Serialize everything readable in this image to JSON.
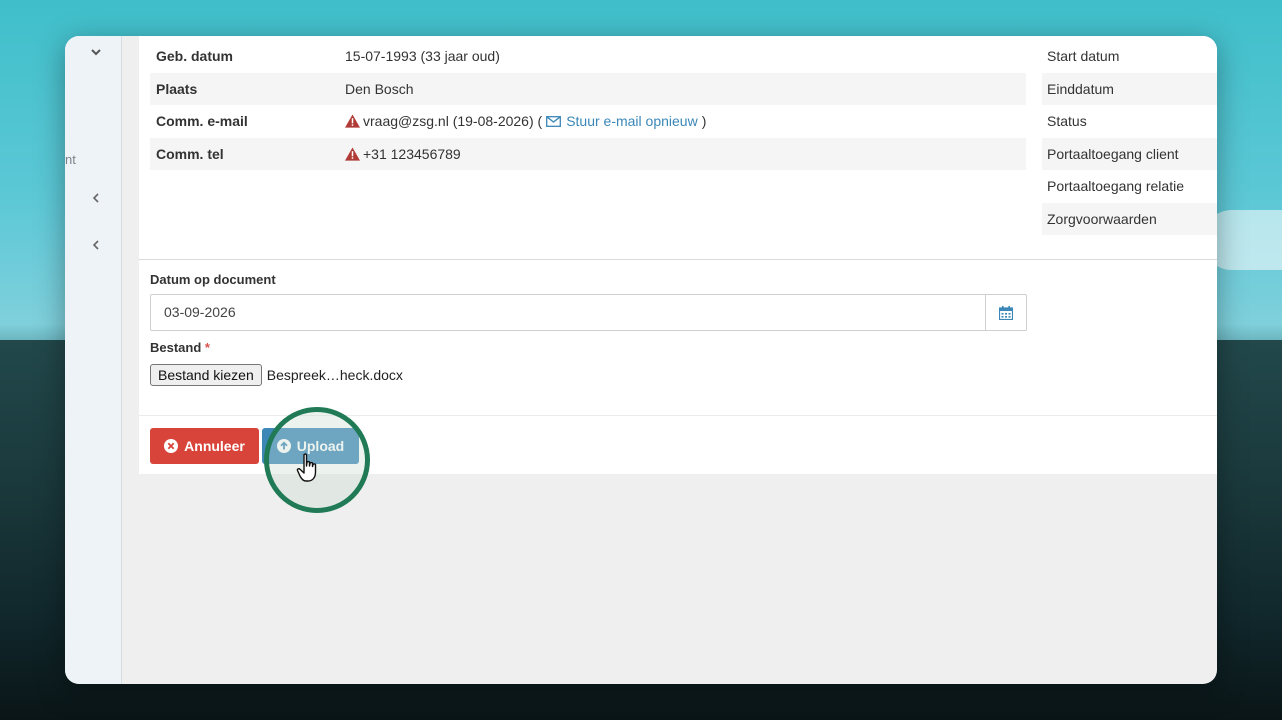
{
  "sidebar": {
    "cut_text": "nt",
    "chevrons": [
      "chevron-down-icon",
      "chevron-left-icon",
      "chevron-left-icon"
    ]
  },
  "client_info": {
    "rows": [
      {
        "label": "Geb. datum",
        "value": "15-07-1993 (33 jaar oud)"
      },
      {
        "label": "Plaats",
        "value": "Den Bosch"
      },
      {
        "label": "Comm. e-mail",
        "value": "vraag@zsg.nl (19-08-2026) (",
        "link": "Stuur e-mail opnieuw",
        "suffix": ")"
      },
      {
        "label": "Comm. tel",
        "value": "+31 123456789"
      }
    ],
    "right_labels": [
      "Start datum",
      "Einddatum",
      "Status",
      "Portaaltoegang client",
      "Portaaltoegang relatie",
      "Zorgvoorwaarden"
    ]
  },
  "form": {
    "date_label": "Datum op document",
    "date_value": "03-09-2026",
    "file_label": "Bestand",
    "required_mark": "*",
    "file_button": "Bestand kiezen",
    "file_name": "Bespreek…heck.docx"
  },
  "actions": {
    "cancel": "Annuleer",
    "upload": "Upload"
  },
  "colors": {
    "cancel": "#d9443a",
    "upload": "#3e88b8",
    "link": "#3a87b8",
    "warning": "#b03a35",
    "highlight_ring": "#1f7a55"
  }
}
